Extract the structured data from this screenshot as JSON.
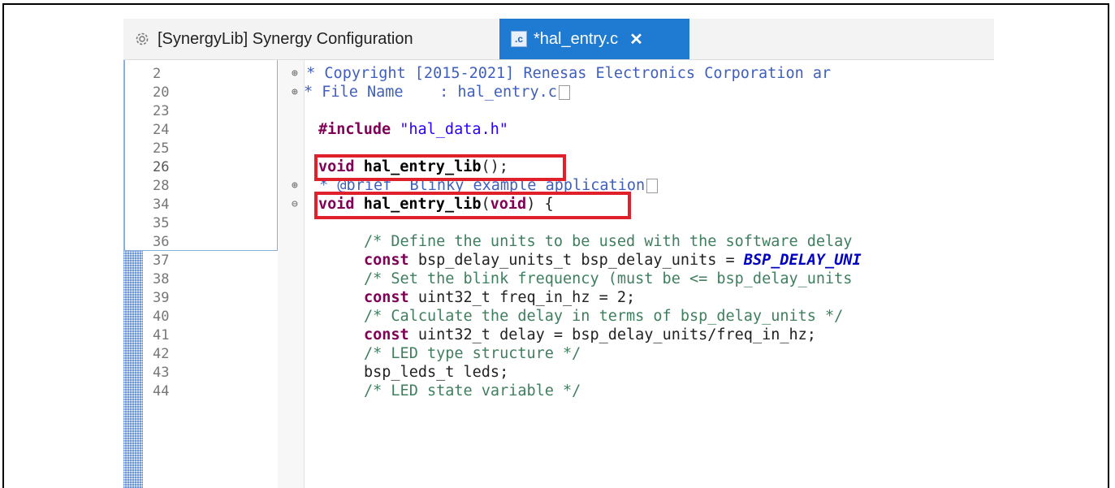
{
  "tabs": [
    {
      "label": "[SynergyLib] Synergy Configuration",
      "icon": "gear-icon",
      "active": false
    },
    {
      "label": "*hal_entry.c",
      "icon": "c-file-icon",
      "icon_text": ".c",
      "close": "✕",
      "active": true
    }
  ],
  "line_numbers": [
    "2",
    "20",
    "23",
    "24",
    "25",
    "26",
    "28",
    "34",
    "35",
    "36",
    "37",
    "38",
    "39",
    "40",
    "41",
    "42",
    "43",
    "44"
  ],
  "fold_markers": [
    "⊕",
    "⊕",
    "⊕",
    "⊖"
  ],
  "code": {
    "line2": " * Copyright [2015-2021] Renesas Electronics Corporation ar",
    "line20": "* File Name    : hal_entry.c",
    "line24_kw": "#include",
    "line24_str": " \"hal_data.h\"",
    "line26_kw": "void",
    "line26_fn": " hal_entry_lib",
    "line26_rest": "();",
    "line28": " * @brief  Blinky example application",
    "line34_kw": "void",
    "line34_fn": " hal_entry_lib",
    "line34_p1": "(",
    "line34_kw2": "void",
    "line34_p2": ") {",
    "line36": "/* Define the units to be used with the software delay",
    "line37_kw": "const",
    "line37_rest": " bsp_delay_units_t bsp_delay_units = ",
    "line37_const": "BSP_DELAY_UNI",
    "line38": "/* Set the blink frequency (must be <= bsp_delay_units",
    "line39_kw": "const",
    "line39_rest": " uint32_t freq_in_hz = 2;",
    "line40": "/* Calculate the delay in terms of bsp_delay_units */",
    "line41_kw": "const",
    "line41_rest": " uint32_t delay = bsp_delay_units/freq_in_hz;",
    "line42": "/* LED type structure */",
    "line43": "bsp_leds_t leds;",
    "line44": "/* LED state variable */"
  },
  "colors": {
    "highlight": "#e0202a",
    "active_tab": "#1f7ad1"
  }
}
